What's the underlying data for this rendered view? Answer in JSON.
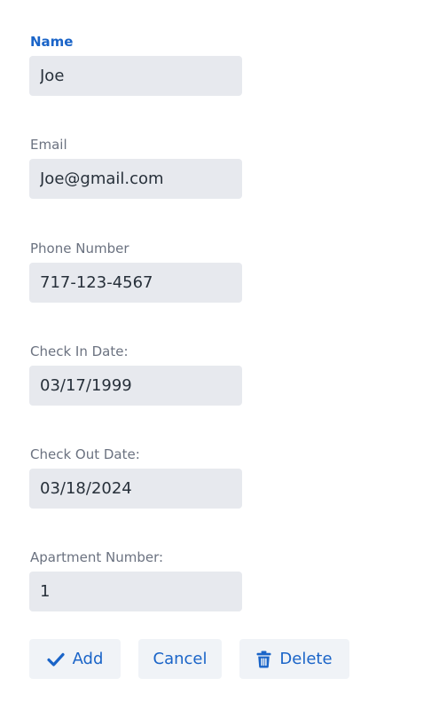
{
  "form": {
    "fields": [
      {
        "label": "Name",
        "value": "Joe"
      },
      {
        "label": "Email",
        "value": "Joe@gmail.com"
      },
      {
        "label": "Phone Number",
        "value": "717-123-4567"
      },
      {
        "label": "Check In Date:",
        "value": "03/17/1999"
      },
      {
        "label": "Check Out Date:",
        "value": "03/18/2024"
      },
      {
        "label": "Apartment Number:",
        "value": "1"
      }
    ],
    "active_field": "Name"
  },
  "buttons": {
    "add_label": "Add",
    "add_icon": "check-icon",
    "cancel_label": "Cancel",
    "delete_label": "Delete",
    "delete_icon": "trash-icon"
  },
  "colors": {
    "accent": "#1a64c8",
    "label": "#6b7280",
    "input_bg": "#e7e9ee",
    "button_bg": "#f0f3f7"
  }
}
